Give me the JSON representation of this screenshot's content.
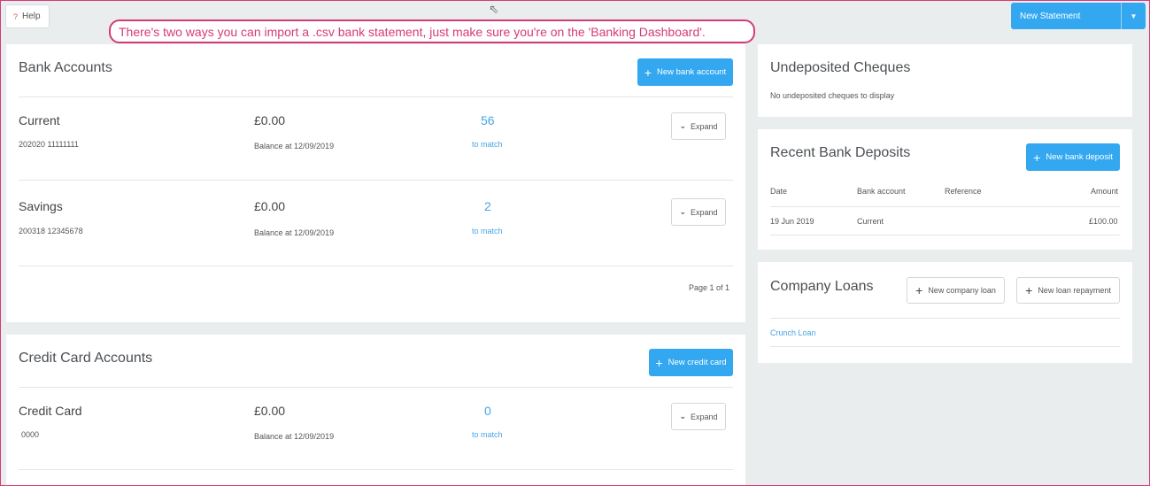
{
  "top": {
    "help_label": "Help",
    "help_icon": "?",
    "callout": "There's two ways you can import a .csv bank statement, just make sure you're on the 'Banking Dashboard'.",
    "new_statement_label": "New Statement"
  },
  "bank_accounts": {
    "title": "Bank Accounts",
    "new_button": "New bank account",
    "accounts": [
      {
        "name": "Current",
        "sub": "202020 11111111",
        "balance": "£0.00",
        "balance_date": "Balance at 12/09/2019",
        "match_count": "56",
        "match_label": "to match",
        "expand": "Expand"
      },
      {
        "name": "Savings",
        "sub": "200318 12345678",
        "balance": "£0.00",
        "balance_date": "Balance at 12/09/2019",
        "match_count": "2",
        "match_label": "to match",
        "expand": "Expand"
      }
    ],
    "page_indicator": "Page 1 of 1"
  },
  "credit_cards": {
    "title": "Credit Card Accounts",
    "new_button": "New credit card",
    "accounts": [
      {
        "name": "Credit Card",
        "sub": "0000",
        "balance": "£0.00",
        "balance_date": "Balance at 12/09/2019",
        "match_count": "0",
        "match_label": "to match",
        "expand": "Expand"
      }
    ]
  },
  "undeposited": {
    "title": "Undeposited Cheques",
    "empty_text": "No undeposited cheques to display"
  },
  "deposits": {
    "title": "Recent Bank Deposits",
    "new_button": "New bank deposit",
    "columns": [
      "Date",
      "Bank account",
      "Reference",
      "Amount"
    ],
    "rows": [
      {
        "date": "19 Jun 2019",
        "account": "Current",
        "reference": "",
        "amount": "£100.00"
      }
    ]
  },
  "loans": {
    "title": "Company Loans",
    "new_loan_button": "New company loan",
    "new_repayment_button": "New loan repayment",
    "items": [
      "Crunch Loan"
    ]
  },
  "colors": {
    "accent": "#33a8f0",
    "link": "#4aa4e6",
    "callout": "#d63a76",
    "background": "#e9edee"
  }
}
